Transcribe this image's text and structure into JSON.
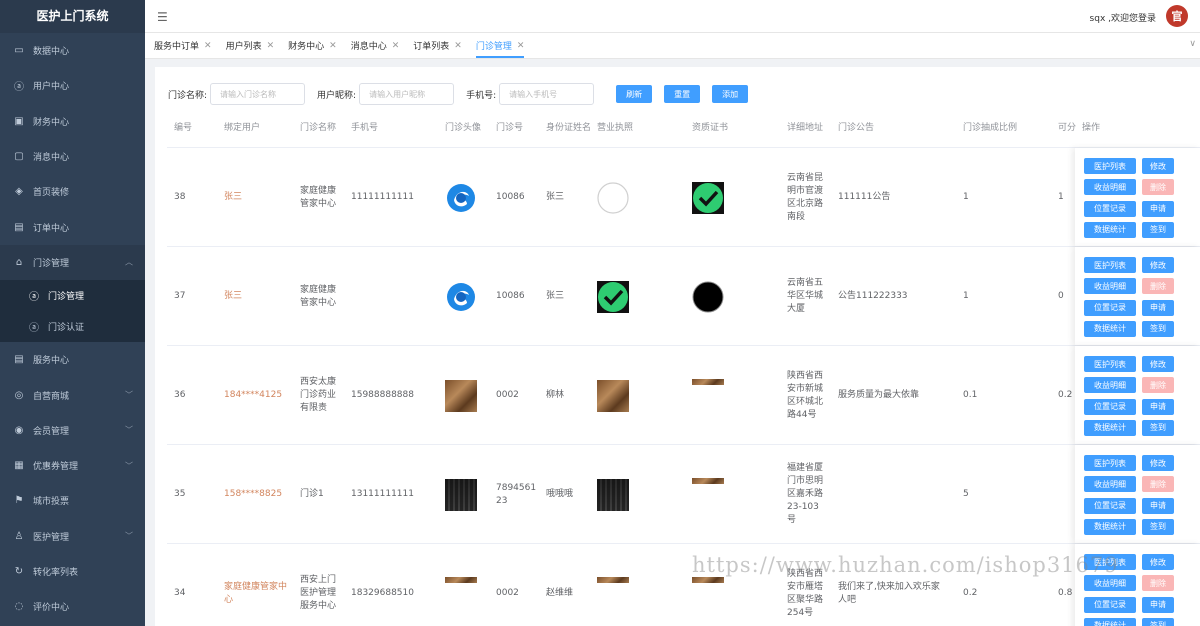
{
  "app": {
    "title": "医护上门系统"
  },
  "header": {
    "welcome": "sqx ,欢迎您登录",
    "avatar_text": "官",
    "menu_icon": "hamburger-icon"
  },
  "sidebar": {
    "items": [
      {
        "label": "数据中心",
        "icon": "monitor-icon"
      },
      {
        "label": "用户中心",
        "icon": "user-icon"
      },
      {
        "label": "财务中心",
        "icon": "wallet-icon"
      },
      {
        "label": "消息中心",
        "icon": "message-icon"
      },
      {
        "label": "首页装修",
        "icon": "box-icon"
      },
      {
        "label": "订单中心",
        "icon": "document-icon"
      },
      {
        "label": "门诊管理",
        "icon": "home-icon",
        "open": true,
        "children": [
          {
            "label": "门诊管理",
            "icon": "user-icon",
            "active": true
          },
          {
            "label": "门诊认证",
            "icon": "user-icon"
          }
        ]
      },
      {
        "label": "服务中心",
        "icon": "document-icon"
      },
      {
        "label": "自营商城",
        "icon": "shop-icon",
        "arrow": true
      },
      {
        "label": "会员管理",
        "icon": "member-icon",
        "arrow": true
      },
      {
        "label": "优惠券管理",
        "icon": "coupon-icon",
        "arrow": true
      },
      {
        "label": "城市投票",
        "icon": "vote-icon"
      },
      {
        "label": "医护管理",
        "icon": "nurse-icon",
        "arrow": true
      },
      {
        "label": "转化率列表",
        "icon": "refresh-icon"
      },
      {
        "label": "评价中心",
        "icon": "comment-icon"
      }
    ]
  },
  "tabs": [
    {
      "label": "服务中订单"
    },
    {
      "label": "用户列表"
    },
    {
      "label": "财务中心"
    },
    {
      "label": "消息中心"
    },
    {
      "label": "订单列表"
    },
    {
      "label": "门诊管理",
      "active": true
    }
  ],
  "search": {
    "clinic_name_label": "门诊名称:",
    "clinic_name_placeholder": "请输入门诊名称",
    "nickname_label": "用户昵称:",
    "nickname_placeholder": "请输入用户昵称",
    "phone_label": "手机号:",
    "phone_placeholder": "请输入手机号",
    "refresh": "刷新",
    "reset": "重置",
    "add": "添加"
  },
  "table": {
    "columns": [
      "编号",
      "绑定用户",
      "门诊名称",
      "手机号",
      "门诊头像",
      "门诊号",
      "身份证姓名",
      "营业执照",
      "资质证书",
      "详细地址",
      "门诊公告",
      "门诊抽成比例",
      "可分",
      "操作"
    ],
    "actions": [
      "医护列表",
      "修改",
      "收益明细",
      "删除",
      "位置记录",
      "申请",
      "数据统计",
      "签到"
    ],
    "rows": [
      {
        "id": "38",
        "user": "张三",
        "clinic": "家庭健康管家中心",
        "phone": "11111111111",
        "avatar": "logo",
        "clinic_no": "10086",
        "id_name": "张三",
        "license": "circle",
        "cert": "check",
        "address": "云南省昆明市官渡区北京路南段",
        "notice": "111111公告",
        "ratio": "1",
        "split": "1"
      },
      {
        "id": "37",
        "user": "张三",
        "clinic": "家庭健康管家中心",
        "phone": "",
        "avatar": "logo",
        "clinic_no": "10086",
        "id_name": "张三",
        "license": "check",
        "cert": "blackcircle",
        "address": "云南省五华区华城大厦",
        "notice": "公告111222333",
        "ratio": "1",
        "split": "0"
      },
      {
        "id": "36",
        "user": "184****4125",
        "clinic": "西安太康门诊药业有限责",
        "phone": "15988888888",
        "avatar": "wood",
        "clinic_no": "0002",
        "id_name": "柳林",
        "license": "wood",
        "cert": "thin",
        "address": "陕西省西安市新城区环城北路44号",
        "notice": "服务质量为最大依靠",
        "ratio": "0.1",
        "split": "0.2"
      },
      {
        "id": "35",
        "user": "158****8825",
        "clinic": "门诊1",
        "phone": "13111111111",
        "avatar": "keys",
        "clinic_no": "7894561 23",
        "id_name": "哦哦哦",
        "license": "keys",
        "cert": "thin",
        "address": "福建省厦门市思明区嘉禾路23-103号",
        "notice": "",
        "ratio": "5",
        "split": ""
      },
      {
        "id": "34",
        "user": "家庭健康管家中心",
        "clinic": "西安上门医护管理服务中心",
        "phone": "18329688510",
        "avatar": "thin",
        "clinic_no": "0002",
        "id_name": "赵维维",
        "license": "thin",
        "cert": "thin",
        "address": "陕西省西安市雁塔区聚华路254号",
        "notice": "我们来了,快来加入欢乐家人吧",
        "ratio": "0.2",
        "split": "0.8"
      }
    ]
  },
  "watermark": "https://www.huzhan.com/ishop31679"
}
